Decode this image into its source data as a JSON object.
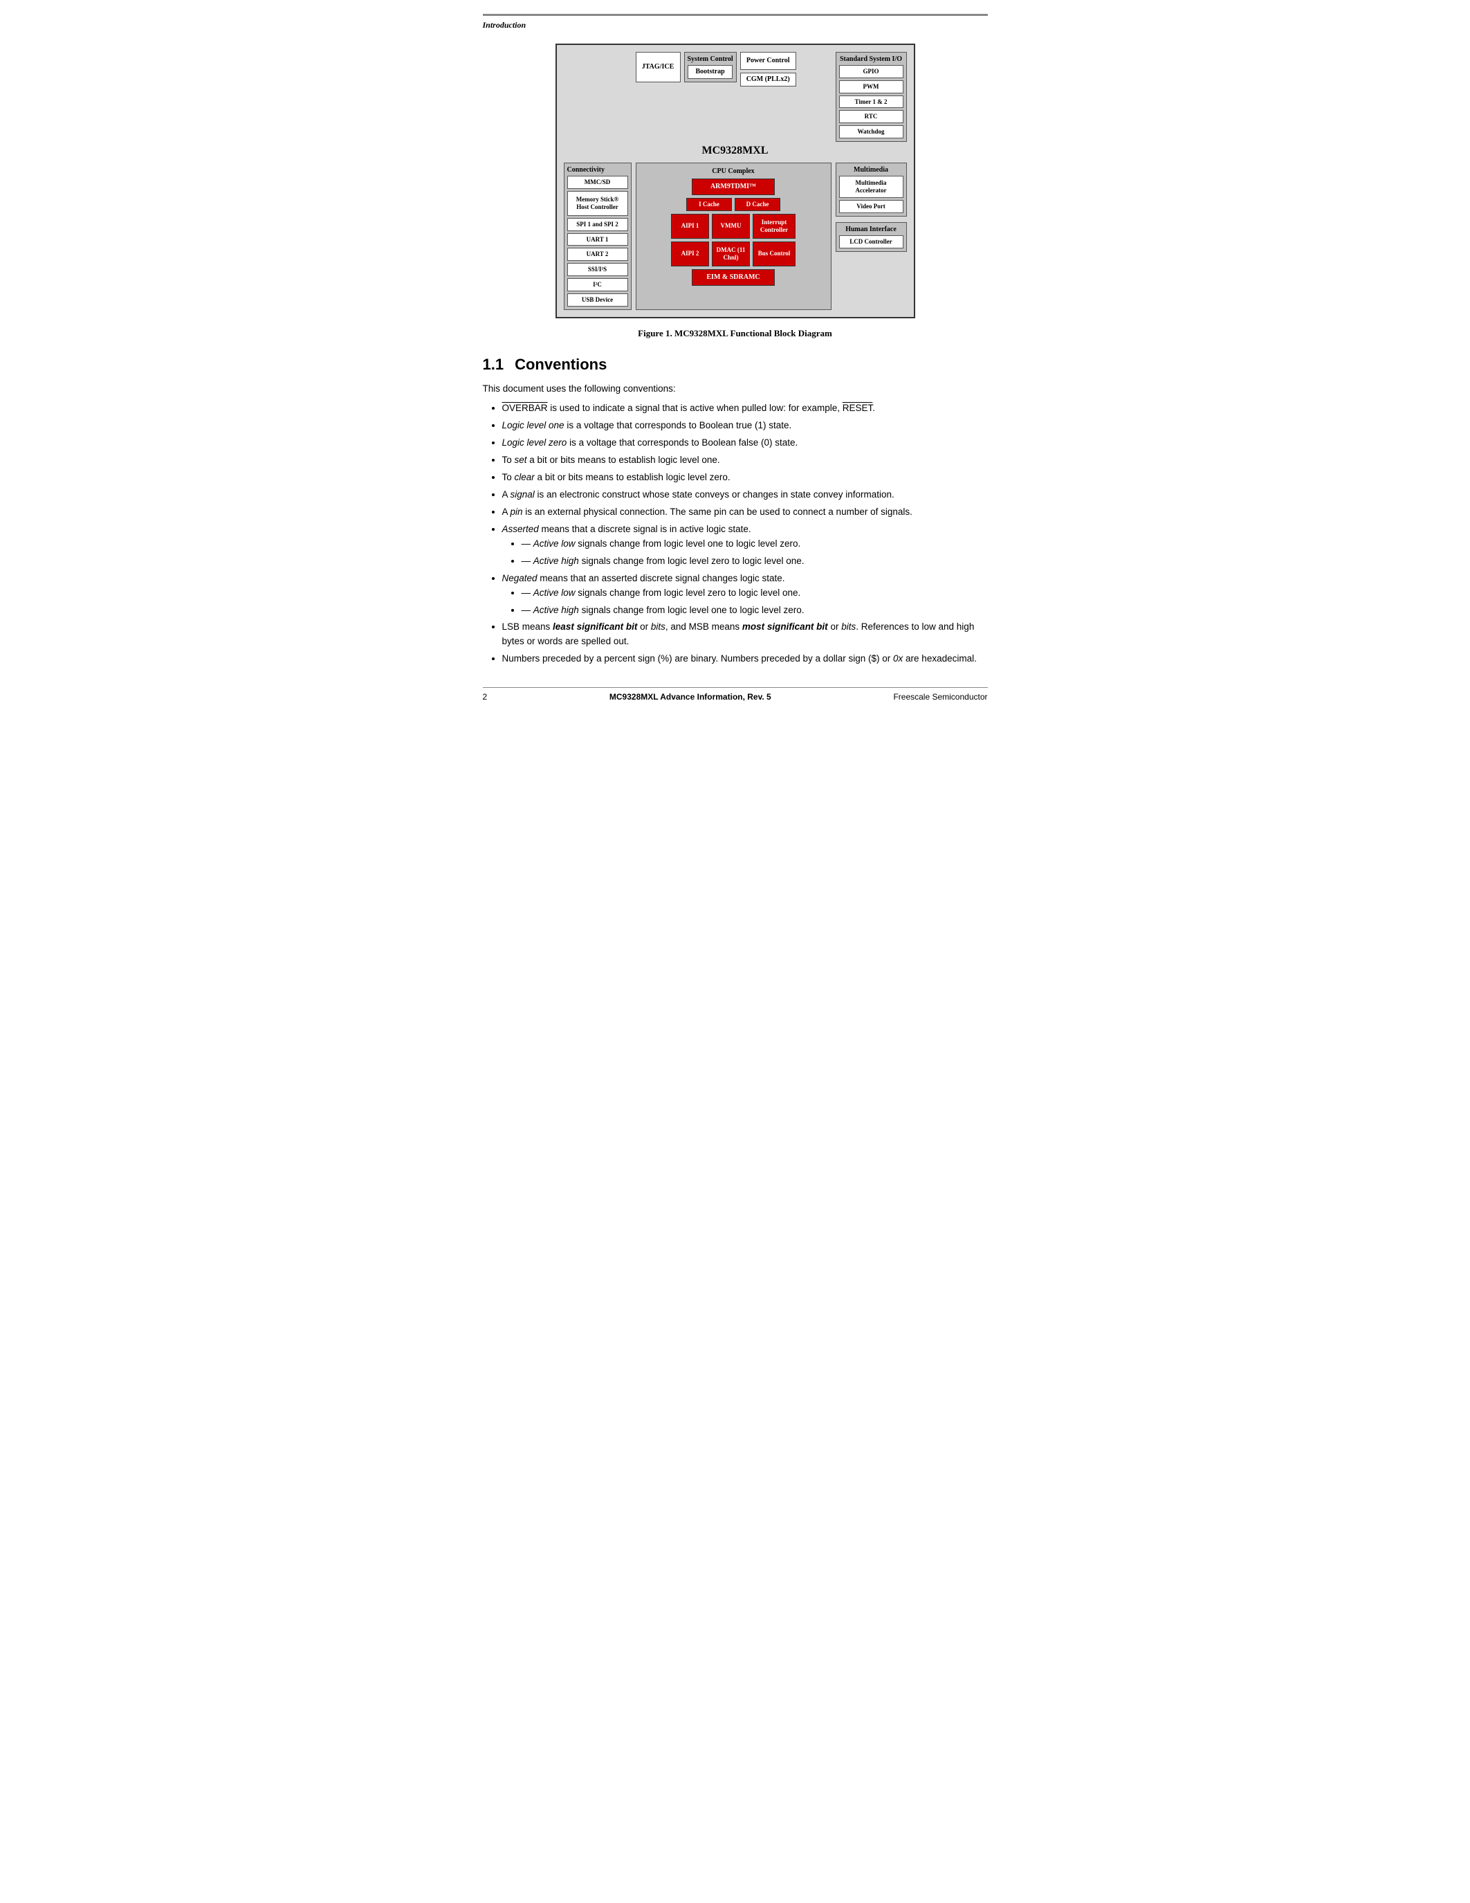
{
  "header": {
    "text": "Introduction"
  },
  "diagram": {
    "title": "MC9328MXL",
    "caption": "Figure 1.   MC9328MXL Functional Block Diagram",
    "blocks": {
      "jtag_ice": "JTAG/ICE",
      "system_control": "System Control",
      "bootstrap": "Bootstrap",
      "power_control": "Power Control",
      "cgm": "CGM (PLLx2)",
      "std_sio": "Standard System I/O",
      "gpio": "GPIO",
      "pwm": "PWM",
      "timer": "Timer 1 & 2",
      "rtc": "RTC",
      "watchdog": "Watchdog",
      "connectivity": "Connectivity",
      "mmc_sd": "MMC/SD",
      "memory_stick": "Memory Stick® Host Controller",
      "spi": "SPI 1 and SPI 2",
      "uart1": "UART 1",
      "uart2": "UART 2",
      "ssi": "SSI/I²S",
      "i2c": "I²C",
      "usb_device": "USB Device",
      "cpu_complex": "CPU Complex",
      "arm9": "ARM9TDMI™",
      "icache": "I Cache",
      "dcache": "D Cache",
      "aipi1": "AIPI 1",
      "vmmu": "VMMU",
      "interrupt_controller": "Interrupt Controller",
      "aipi2": "AIPI 2",
      "dmac": "DMAC (11 Chnl)",
      "bus_control": "Bus Control",
      "eim_sdramc": "EIM & SDRAMC",
      "multimedia": "Multimedia",
      "multimedia_accelerator": "Multimedia Accelerator",
      "video_port": "Video Port",
      "human_interface": "Human Interface",
      "lcd_controller": "LCD Controller"
    }
  },
  "section": {
    "number": "1.1",
    "title": "Conventions"
  },
  "content": {
    "intro": "This document uses the following conventions:",
    "bullets": [
      {
        "text_parts": [
          {
            "style": "overline",
            "text": "OVERBAR"
          },
          {
            "style": "normal",
            "text": " is used to indicate a signal that is active when pulled low: for example, "
          },
          {
            "style": "overline",
            "text": "RESET"
          },
          {
            "style": "normal",
            "text": "."
          }
        ]
      },
      {
        "text_parts": [
          {
            "style": "italic",
            "text": "Logic level one"
          },
          {
            "style": "normal",
            "text": " is a voltage that corresponds to Boolean true (1) state."
          }
        ]
      },
      {
        "text_parts": [
          {
            "style": "italic",
            "text": "Logic level zero"
          },
          {
            "style": "normal",
            "text": " is a voltage that corresponds to Boolean false (0) state."
          }
        ]
      },
      {
        "text_parts": [
          {
            "style": "normal",
            "text": "To "
          },
          {
            "style": "italic",
            "text": "set"
          },
          {
            "style": "normal",
            "text": " a bit or bits means to establish logic level one."
          }
        ]
      },
      {
        "text_parts": [
          {
            "style": "normal",
            "text": "To "
          },
          {
            "style": "italic",
            "text": "clear"
          },
          {
            "style": "normal",
            "text": " a bit or bits means to establish logic level zero."
          }
        ]
      },
      {
        "text_parts": [
          {
            "style": "normal",
            "text": "A "
          },
          {
            "style": "italic",
            "text": "signal"
          },
          {
            "style": "normal",
            "text": " is an electronic construct whose state conveys or changes in state convey information."
          }
        ]
      },
      {
        "text_parts": [
          {
            "style": "normal",
            "text": "A "
          },
          {
            "style": "italic",
            "text": "pin"
          },
          {
            "style": "normal",
            "text": " is an external physical connection. The same pin can be used to connect a number of signals."
          }
        ]
      },
      {
        "text_parts": [
          {
            "style": "italic",
            "text": "Asserted"
          },
          {
            "style": "normal",
            "text": " means that a discrete signal is in active logic state."
          }
        ],
        "sub_bullets": [
          {
            "text_parts": [
              {
                "style": "italic",
                "text": "Active low"
              },
              {
                "style": "normal",
                "text": " signals change from logic level one to logic level zero."
              }
            ]
          },
          {
            "text_parts": [
              {
                "style": "italic",
                "text": "Active high"
              },
              {
                "style": "normal",
                "text": " signals change from logic level zero to logic level one."
              }
            ]
          }
        ]
      },
      {
        "text_parts": [
          {
            "style": "italic",
            "text": "Negated"
          },
          {
            "style": "normal",
            "text": " means that an asserted discrete signal changes logic state."
          }
        ],
        "sub_bullets": [
          {
            "text_parts": [
              {
                "style": "italic",
                "text": "Active low"
              },
              {
                "style": "normal",
                "text": " signals change from logic level zero to logic level one."
              }
            ]
          },
          {
            "text_parts": [
              {
                "style": "italic",
                "text": "Active high"
              },
              {
                "style": "normal",
                "text": " signals change from logic level one to logic level zero."
              }
            ]
          }
        ]
      },
      {
        "text_parts": [
          {
            "style": "normal",
            "text": "LSB means "
          },
          {
            "style": "bold-italic",
            "text": "least significant bit"
          },
          {
            "style": "normal",
            "text": " or "
          },
          {
            "style": "italic",
            "text": "bits"
          },
          {
            "style": "normal",
            "text": ", and MSB means "
          },
          {
            "style": "bold-italic",
            "text": "most significant bit"
          },
          {
            "style": "normal",
            "text": " or "
          },
          {
            "style": "italic",
            "text": "bits"
          },
          {
            "style": "normal",
            "text": ". References to low and high bytes or words are spelled out."
          }
        ]
      },
      {
        "text_parts": [
          {
            "style": "normal",
            "text": "Numbers preceded by a percent sign (%) are binary. Numbers preceded by a dollar sign ($) or "
          },
          {
            "style": "italic",
            "text": "0x"
          },
          {
            "style": "normal",
            "text": " are hexadecimal."
          }
        ]
      }
    ]
  },
  "footer": {
    "page_number": "2",
    "center_text": "MC9328MXL Advance Information, Rev. 5",
    "company": "Freescale Semiconductor"
  }
}
